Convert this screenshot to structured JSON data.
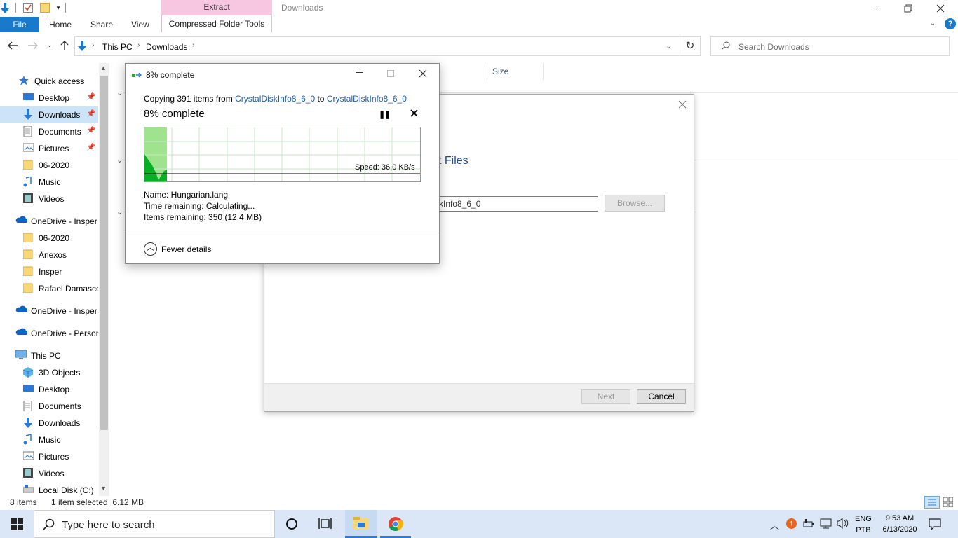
{
  "window": {
    "title": "Downloads",
    "context_tab_header": "Extract"
  },
  "ribbon": {
    "file": "File",
    "home": "Home",
    "share": "Share",
    "view": "View",
    "compressed_folder_tools": "Compressed Folder Tools"
  },
  "address": {
    "crumbs": [
      "This PC",
      "Downloads"
    ],
    "search_placeholder": "Search Downloads"
  },
  "sidebar": {
    "items": [
      {
        "label": "Quick access",
        "icon": "star-icon"
      },
      {
        "label": "Desktop",
        "icon": "desktop-icon",
        "pinned": true
      },
      {
        "label": "Downloads",
        "icon": "download-arrow-icon",
        "pinned": true,
        "selected": true
      },
      {
        "label": "Documents",
        "icon": "documents-icon",
        "pinned": true
      },
      {
        "label": "Pictures",
        "icon": "pictures-icon",
        "pinned": true
      },
      {
        "label": "06-2020",
        "icon": "folder-icon"
      },
      {
        "label": "Music",
        "icon": "music-icon"
      },
      {
        "label": "Videos",
        "icon": "videos-icon"
      },
      {
        "label": "OneDrive - Insper",
        "icon": "onedrive-icon"
      },
      {
        "label": "06-2020",
        "icon": "folder-icon"
      },
      {
        "label": "Anexos",
        "icon": "folder-icon"
      },
      {
        "label": "Insper",
        "icon": "folder-icon"
      },
      {
        "label": "Rafael Damasceno",
        "icon": "folder-icon"
      },
      {
        "label": "OneDrive - Insper",
        "icon": "onedrive-icon"
      },
      {
        "label": "OneDrive - Personal",
        "icon": "onedrive-icon"
      },
      {
        "label": "This PC",
        "icon": "pc-icon"
      },
      {
        "label": "3D Objects",
        "icon": "cube-icon"
      },
      {
        "label": "Desktop",
        "icon": "desktop-icon"
      },
      {
        "label": "Documents",
        "icon": "documents-icon"
      },
      {
        "label": "Downloads",
        "icon": "download-arrow-icon"
      },
      {
        "label": "Music",
        "icon": "music-icon"
      },
      {
        "label": "Pictures",
        "icon": "pictures-icon"
      },
      {
        "label": "Videos",
        "icon": "videos-icon"
      },
      {
        "label": "Local Disk (C:)",
        "icon": "disk-icon"
      }
    ]
  },
  "columns": {
    "size": "Size"
  },
  "status": {
    "count": "8 items",
    "selection": "1 item selected  6.12 MB"
  },
  "wizard": {
    "heading_fragment": "t Files",
    "path_fragment": "kInfo8_6_0",
    "browse": "Browse...",
    "next": "Next",
    "cancel": "Cancel"
  },
  "copy": {
    "title": "8% complete",
    "copying_prefix": "Copying 391 items from ",
    "from": "CrystalDiskInfo8_6_0",
    "to_word": " to ",
    "to": "CrystalDiskInfo8_6_0",
    "progress_text": "8% complete",
    "progress": 0.08,
    "speed": "Speed: 36.0 KB/s",
    "name_line": "Name:  Hungarian.lang",
    "time_line": "Time remaining:  Calculating...",
    "items_line": "Items remaining:  350 (12.4 MB)",
    "fewer_details": "Fewer details"
  },
  "taskbar": {
    "search_placeholder": "Type here to search",
    "lang": "ENG",
    "layout": "PTB",
    "time": "9:53 AM",
    "date": "6/13/2020"
  },
  "colors": {
    "file_tab": "#1979ca",
    "context_tab": "#f7c6e0",
    "link": "#1a5fb4",
    "progress_fill": "#06b025",
    "selection": "#cce4f7"
  }
}
